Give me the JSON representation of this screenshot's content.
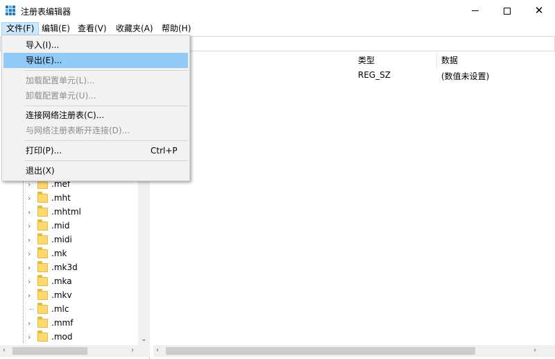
{
  "window": {
    "title": "注册表编辑器",
    "controls": {
      "minimize": "minimize",
      "maximize": "maximize",
      "close": "close"
    }
  },
  "menubar": {
    "items": [
      {
        "label": "文件(F)",
        "active": true
      },
      {
        "label": "编辑(E)"
      },
      {
        "label": "查看(V)"
      },
      {
        "label": "收藏夹(A)"
      },
      {
        "label": "帮助(H)"
      }
    ]
  },
  "file_menu": {
    "items": [
      {
        "label": "导入(I)...",
        "enabled": true
      },
      {
        "label": "导出(E)...",
        "enabled": true,
        "highlighted": true
      },
      {
        "label": "加载配置单元(L)...",
        "enabled": false
      },
      {
        "label": "卸载配置单元(U)...",
        "enabled": false
      },
      {
        "label": "连接网络注册表(C)...",
        "enabled": true
      },
      {
        "label": "与网络注册表断开连接(D)...",
        "enabled": false
      },
      {
        "label": "打印(P)...",
        "shortcut": "Ctrl+P",
        "enabled": true
      },
      {
        "label": "退出(X)",
        "enabled": true
      }
    ]
  },
  "tree": {
    "items": [
      {
        "label": ".mef",
        "expandable": true
      },
      {
        "label": ".mht",
        "expandable": true
      },
      {
        "label": ".mhtml",
        "expandable": true
      },
      {
        "label": ".mid",
        "expandable": true
      },
      {
        "label": ".midi",
        "expandable": true
      },
      {
        "label": ".mk",
        "expandable": true
      },
      {
        "label": ".mk3d",
        "expandable": true
      },
      {
        "label": ".mka",
        "expandable": true
      },
      {
        "label": ".mkv",
        "expandable": true
      },
      {
        "label": ".mlc",
        "expandable": false
      },
      {
        "label": ".mmf",
        "expandable": true
      },
      {
        "label": ".mod",
        "expandable": true
      }
    ]
  },
  "values_table": {
    "columns": {
      "type": "类型",
      "data": "数据"
    },
    "rows": [
      {
        "name_fragment": ")",
        "type": "REG_SZ",
        "data": "(数值未设置)"
      }
    ]
  },
  "colors": {
    "menu_highlight": "#91c9f7",
    "menubar_active": "#cce8ff",
    "folder": "#ffd96b",
    "disabled_text": "#8d8d8d"
  }
}
